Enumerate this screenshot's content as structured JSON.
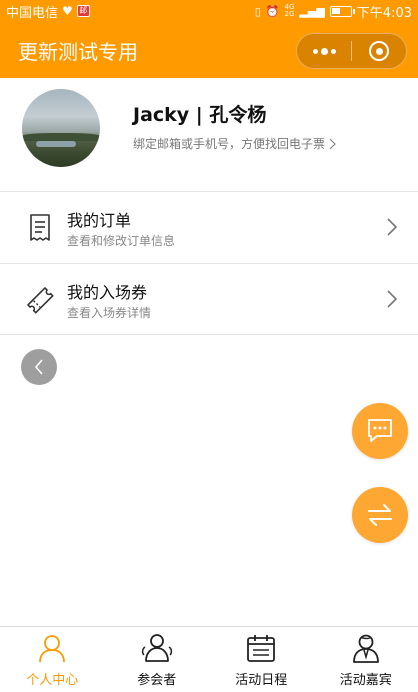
{
  "status_bar": {
    "carrier": "中国电信",
    "badge": "邮",
    "network": [
      "4G",
      "2G"
    ],
    "time": "下午4:03"
  },
  "header": {
    "title": "更新测试专用"
  },
  "profile": {
    "name": "Jacky | 孔令杨",
    "hint": "绑定邮箱或手机号，方便找回电子票"
  },
  "menu": [
    {
      "title": "我的订单",
      "subtitle": "查看和修改订单信息",
      "icon": "receipt-icon"
    },
    {
      "title": "我的入场券",
      "subtitle": "查看入场券详情",
      "icon": "ticket-icon"
    }
  ],
  "tabs": [
    {
      "label": "个人中心",
      "icon": "person-icon",
      "active": true
    },
    {
      "label": "参会者",
      "icon": "attendees-icon",
      "active": false
    },
    {
      "label": "活动日程",
      "icon": "calendar-icon",
      "active": false
    },
    {
      "label": "活动嘉宾",
      "icon": "guests-icon",
      "active": false
    }
  ],
  "colors": {
    "brand": "#ff9a00",
    "fab": "#ffa733",
    "back_button": "#9e9e9e"
  },
  "battery_level": 0.45
}
